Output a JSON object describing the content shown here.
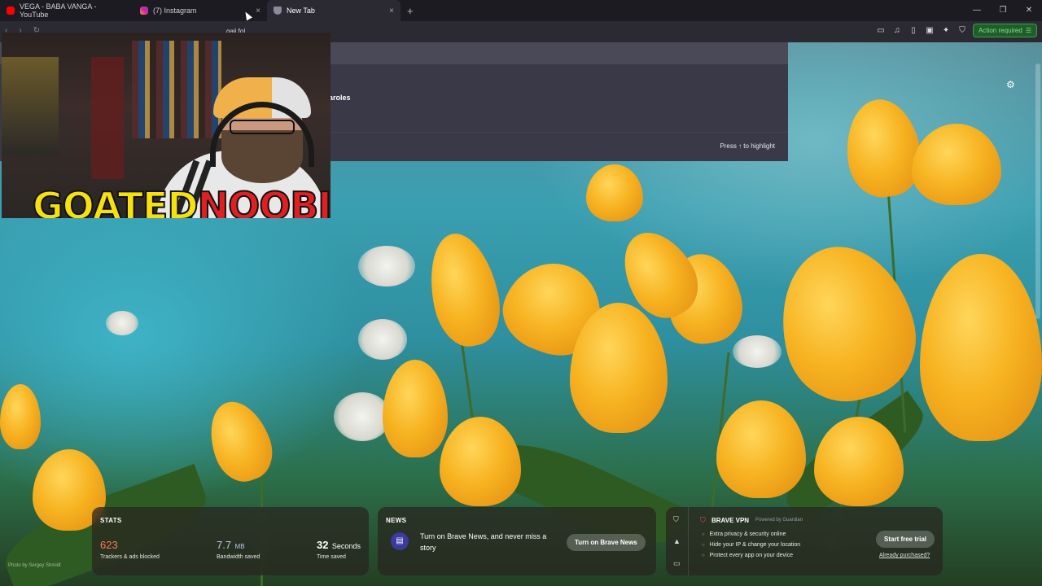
{
  "tabs": [
    {
      "title": "VEGA - BABA VANGA - YouTube",
      "favicon": "youtube-icon",
      "color": "#ff0000",
      "active": false
    },
    {
      "title": "(7) Instagram",
      "favicon": "instagram-icon",
      "color": "#d6249f",
      "active": false
    },
    {
      "title": "New Tab",
      "favicon": "brave-shield-icon",
      "color": "#8a8a9a",
      "active": true
    }
  ],
  "tab_close_glyph": "×",
  "new_tab_glyph": "+",
  "window_controls": {
    "minimize": "—",
    "restore": "❐",
    "close": "✕"
  },
  "toolbar": {
    "address_text": "gaji fo|",
    "action_required_label": "Action required",
    "accent_color": "#3ea048"
  },
  "omnibox": {
    "suggestion_text": "aroles",
    "hint": "Press ↑ to highlight"
  },
  "webcam_overlay": {
    "logo_text_yellow": "GOATED",
    "logo_text_red": "NOOBIE"
  },
  "stats_widget": {
    "title": "STATS",
    "trackers_value": "623",
    "trackers_label": "Trackers & ads blocked",
    "bandwidth_value": "7.7",
    "bandwidth_unit": "MB",
    "bandwidth_label": "Bandwidth saved",
    "time_value": "32",
    "time_unit": "Seconds",
    "time_label": "Time saved"
  },
  "news_widget": {
    "title": "NEWS",
    "text": "Turn on Brave News, and never miss a story",
    "button": "Turn on Brave News"
  },
  "vpn_widget": {
    "title": "BRAVE VPN",
    "powered_by": "Powered by Guardian",
    "features": [
      "Extra privacy & security online",
      "Hide your IP & change your location",
      "Protect every app on your device"
    ],
    "trial_button": "Start free trial",
    "purchased_link": "Already purchased?"
  },
  "photo_credit": "Photo by Sergey Shmidt"
}
